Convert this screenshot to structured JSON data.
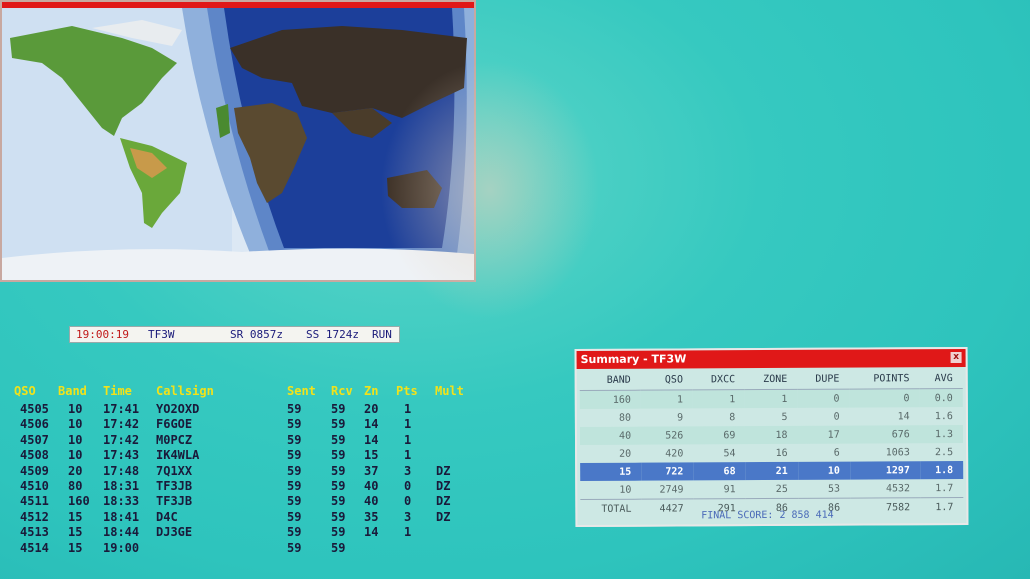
{
  "status_bar": {
    "clock": "19:00:19",
    "callsign": "TF3W",
    "sunrise": "SR 0857z",
    "sunset": "SS 1724z",
    "mode": "RUN"
  },
  "log": {
    "headers": [
      "QSO",
      "Band",
      "Time",
      "Callsign",
      "Sent",
      "Rcv",
      "Zn",
      "Pts",
      "Mult"
    ],
    "rows": [
      {
        "qso": "4505",
        "band": "10",
        "time": "17:41",
        "call": "YO2OXD",
        "sent": "59",
        "rcv": "59",
        "zn": "20",
        "pts": "1",
        "mult": ""
      },
      {
        "qso": "4506",
        "band": "10",
        "time": "17:42",
        "call": "F6GOE",
        "sent": "59",
        "rcv": "59",
        "zn": "14",
        "pts": "1",
        "mult": ""
      },
      {
        "qso": "4507",
        "band": "10",
        "time": "17:42",
        "call": "M0PCZ",
        "sent": "59",
        "rcv": "59",
        "zn": "14",
        "pts": "1",
        "mult": ""
      },
      {
        "qso": "4508",
        "band": "10",
        "time": "17:43",
        "call": "IK4WLA",
        "sent": "59",
        "rcv": "59",
        "zn": "15",
        "pts": "1",
        "mult": ""
      },
      {
        "qso": "4509",
        "band": "20",
        "time": "17:48",
        "call": "7Q1XX",
        "sent": "59",
        "rcv": "59",
        "zn": "37",
        "pts": "3",
        "mult": "DZ"
      },
      {
        "qso": "4510",
        "band": "80",
        "time": "18:31",
        "call": "TF3JB",
        "sent": "59",
        "rcv": "59",
        "zn": "40",
        "pts": "0",
        "mult": "DZ"
      },
      {
        "qso": "4511",
        "band": "160",
        "time": "18:33",
        "call": "TF3JB",
        "sent": "59",
        "rcv": "59",
        "zn": "40",
        "pts": "0",
        "mult": "DZ"
      },
      {
        "qso": "4512",
        "band": "15",
        "time": "18:41",
        "call": "D4C",
        "sent": "59",
        "rcv": "59",
        "zn": "35",
        "pts": "3",
        "mult": "DZ"
      },
      {
        "qso": "4513",
        "band": "15",
        "time": "18:44",
        "call": "DJ3GE",
        "sent": "59",
        "rcv": "59",
        "zn": "14",
        "pts": "1",
        "mult": ""
      },
      {
        "qso": "4514",
        "band": "15",
        "time": "19:00",
        "call": "",
        "sent": "59",
        "rcv": "59",
        "zn": "",
        "pts": "",
        "mult": ""
      }
    ]
  },
  "summary": {
    "title": "Summary - TF3W",
    "close_label": "x",
    "headers": [
      "BAND",
      "QSO",
      "DXCC",
      "ZONE",
      "DUPE",
      "POINTS",
      "AVG"
    ],
    "rows": [
      {
        "band": "160",
        "qso": "1",
        "dxcc": "1",
        "zone": "1",
        "dupe": "0",
        "points": "0",
        "avg": "0.0",
        "selected": false
      },
      {
        "band": "80",
        "qso": "9",
        "dxcc": "8",
        "zone": "5",
        "dupe": "0",
        "points": "14",
        "avg": "1.6",
        "selected": false
      },
      {
        "band": "40",
        "qso": "526",
        "dxcc": "69",
        "zone": "18",
        "dupe": "17",
        "points": "676",
        "avg": "1.3",
        "selected": false
      },
      {
        "band": "20",
        "qso": "420",
        "dxcc": "54",
        "zone": "16",
        "dupe": "6",
        "points": "1063",
        "avg": "2.5",
        "selected": false
      },
      {
        "band": "15",
        "qso": "722",
        "dxcc": "68",
        "zone": "21",
        "dupe": "10",
        "points": "1297",
        "avg": "1.8",
        "selected": true
      },
      {
        "band": "10",
        "qso": "2749",
        "dxcc": "91",
        "zone": "25",
        "dupe": "53",
        "points": "4532",
        "avg": "1.7",
        "selected": false
      }
    ],
    "total": {
      "band": "TOTAL",
      "qso": "4427",
      "dxcc": "291",
      "zone": "86",
      "dupe": "86",
      "points": "7582",
      "avg": "1.7"
    },
    "final_score": "FINAL SCORE: 2 858 414"
  },
  "colors": {
    "background": "#2ec4bd",
    "header_yellow": "#f2e21a",
    "title_red": "#e01818",
    "selected_row": "#4a78c8",
    "clock_red": "#c01818"
  }
}
